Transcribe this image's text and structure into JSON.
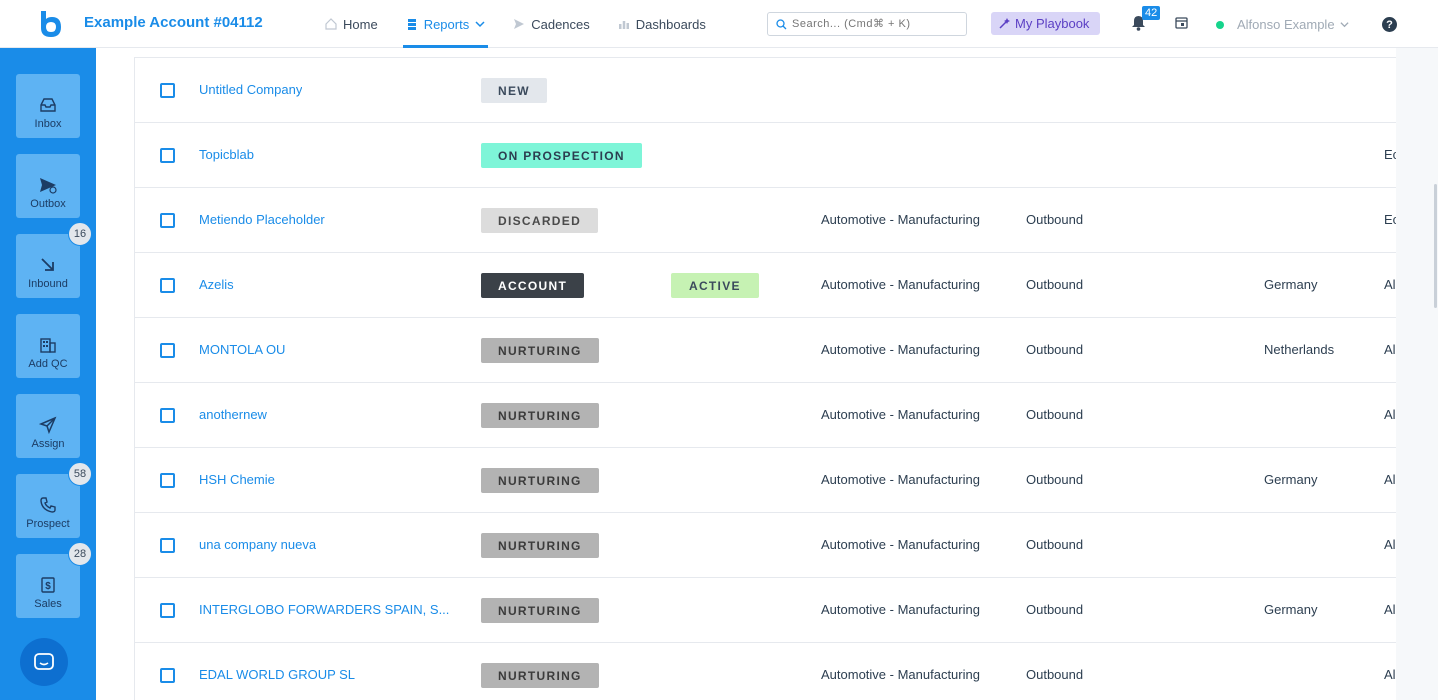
{
  "header": {
    "account_name": "Example Account #04112",
    "nav": [
      {
        "label": "Home",
        "icon": "home-icon"
      },
      {
        "label": "Reports",
        "icon": "reports-icon",
        "active": true
      },
      {
        "label": "Cadences",
        "icon": "cadences-icon"
      },
      {
        "label": "Dashboards",
        "icon": "dashboards-icon"
      }
    ],
    "search_placeholder": "Search... (Cmd⌘ + K)",
    "playbook_label": "My Playbook",
    "notification_count": "42",
    "user_name": "Alfonso Example",
    "help_label": "?"
  },
  "sidebar": {
    "items": [
      {
        "label": "Inbox",
        "icon": "inbox-icon"
      },
      {
        "label": "Outbox",
        "icon": "outbox-icon"
      },
      {
        "label": "Inbound",
        "icon": "inbound-arrow-icon",
        "badge": "16"
      },
      {
        "label": "Add QC",
        "icon": "building-icon"
      },
      {
        "label": "Assign",
        "icon": "send-icon"
      },
      {
        "label": "Prospect",
        "icon": "phone-icon",
        "badge": "58"
      },
      {
        "label": "Sales",
        "icon": "dollar-icon",
        "badge": "28"
      }
    ]
  },
  "colors": {
    "accent": "#1a8ce8",
    "sidebar": "#1a8ce8",
    "sidebar_button": "#5eb3f3"
  },
  "rows": [
    {
      "name": "Untitled Company",
      "status": "NEW",
      "status_class": "new",
      "status2": "",
      "industry": "",
      "source": "",
      "country": "",
      "last": ""
    },
    {
      "name": "Topicblab",
      "status": "ON PROSPECTION",
      "status_class": "prosp",
      "status2": "",
      "industry": "",
      "source": "",
      "country": "",
      "last": "Ec"
    },
    {
      "name": "Metiendo Placeholder",
      "status": "DISCARDED",
      "status_class": "disc",
      "status2": "",
      "industry": "Automotive - Manufacturing",
      "source": "Outbound",
      "country": "",
      "last": "Ec"
    },
    {
      "name": "Azelis",
      "status": "ACCOUNT",
      "status_class": "acct",
      "status2": "ACTIVE",
      "industry": "Automotive - Manufacturing",
      "source": "Outbound",
      "country": "Germany",
      "last": "Al"
    },
    {
      "name": "MONTOLA OU",
      "status": "NURTURING",
      "status_class": "nurt",
      "status2": "",
      "industry": "Automotive - Manufacturing",
      "source": "Outbound",
      "country": "Netherlands",
      "last": "Al"
    },
    {
      "name": "anothernew",
      "status": "NURTURING",
      "status_class": "nurt",
      "status2": "",
      "industry": "Automotive - Manufacturing",
      "source": "Outbound",
      "country": "",
      "last": "Al"
    },
    {
      "name": "HSH Chemie",
      "status": "NURTURING",
      "status_class": "nurt",
      "status2": "",
      "industry": "Automotive - Manufacturing",
      "source": "Outbound",
      "country": "Germany",
      "last": "Al"
    },
    {
      "name": "una company nueva",
      "status": "NURTURING",
      "status_class": "nurt",
      "status2": "",
      "industry": "Automotive - Manufacturing",
      "source": "Outbound",
      "country": "",
      "last": "Al"
    },
    {
      "name": "INTERGLOBO FORWARDERS SPAIN, S...",
      "status": "NURTURING",
      "status_class": "nurt",
      "status2": "",
      "industry": "Automotive - Manufacturing",
      "source": "Outbound",
      "country": "Germany",
      "last": "Al"
    },
    {
      "name": "EDAL WORLD GROUP SL",
      "status": "NURTURING",
      "status_class": "nurt",
      "status2": "",
      "industry": "Automotive - Manufacturing",
      "source": "Outbound",
      "country": "",
      "last": "Al"
    }
  ]
}
